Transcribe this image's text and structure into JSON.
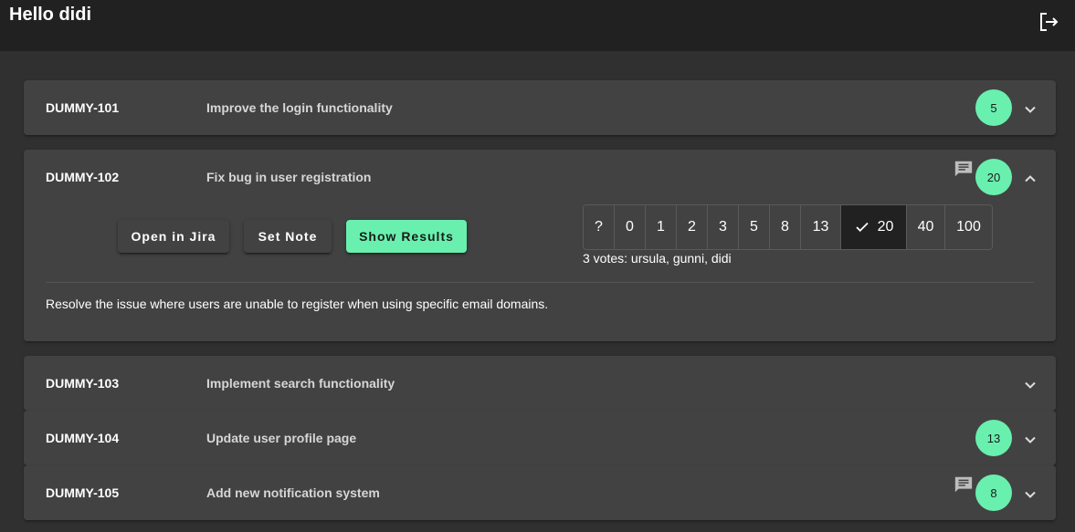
{
  "header": {
    "greeting": "Hello didi",
    "logout_icon": "logout-icon"
  },
  "issues": [
    {
      "key": "DUMMY-101",
      "title": "Improve the login functionality",
      "estimate": "5"
    },
    {
      "key": "DUMMY-102",
      "title": "Fix bug in user registration",
      "estimate": "20",
      "buttons": {
        "open_jira": "Open in Jira",
        "set_note": "Set Note",
        "show_results": "Show Results"
      },
      "cards": [
        "?",
        "0",
        "1",
        "2",
        "3",
        "5",
        "8",
        "13",
        "20",
        "40",
        "100"
      ],
      "selected_card": "20",
      "votes": "3 votes: ursula, gunni, didi",
      "description": "Resolve the issue where users are unable to register when using specific email domains."
    },
    {
      "key": "DUMMY-103",
      "title": "Implement search functionality"
    },
    {
      "key": "DUMMY-104",
      "title": "Update user profile page",
      "estimate": "13"
    },
    {
      "key": "DUMMY-105",
      "title": "Add new notification system",
      "estimate": "8"
    }
  ],
  "colors": {
    "accent": "#69f0ae",
    "panel": "#424242",
    "background": "#303030",
    "toolbar": "#212121"
  }
}
